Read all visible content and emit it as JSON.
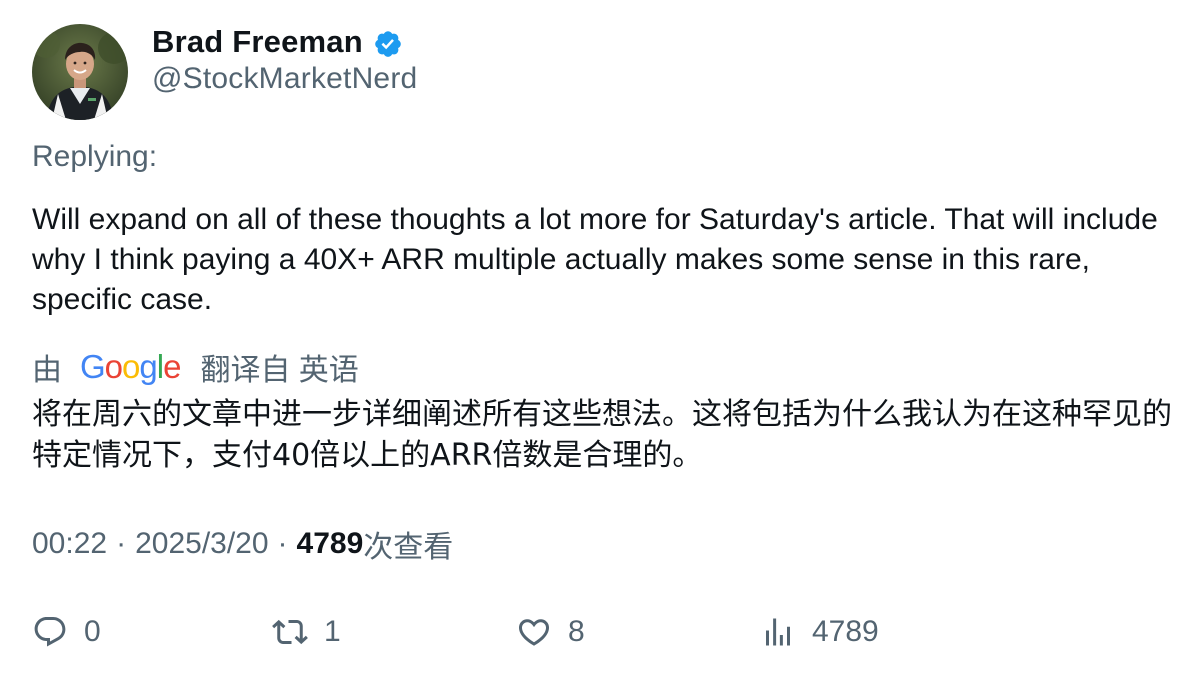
{
  "user": {
    "display_name": "Brad Freeman",
    "handle": "@StockMarketNerd",
    "verified": true,
    "verified_color": "#1d9bf0"
  },
  "tweet": {
    "replying_label": "Replying:",
    "text": "Will expand on all of these thoughts a lot more for Saturday's article. That will include why I think paying a 40X+ ARR multiple actually makes some sense in this rare, specific case."
  },
  "translation": {
    "by_label": "由",
    "provider": "Google",
    "provider_letters": [
      {
        "ch": "G",
        "color": "#4285F4"
      },
      {
        "ch": "o",
        "color": "#EA4335"
      },
      {
        "ch": "o",
        "color": "#FBBC05"
      },
      {
        "ch": "g",
        "color": "#4285F4"
      },
      {
        "ch": "l",
        "color": "#34A853"
      },
      {
        "ch": "e",
        "color": "#EA4335"
      }
    ],
    "translated_from_label": "翻译自 英语",
    "text": "将在周六的文章中进一步详细阐述所有这些想法。这将包括为什么我认为在这种罕见的特定情况下，支付40倍以上的ARR倍数是合理的。"
  },
  "meta": {
    "time": "00:22",
    "separator": "·",
    "date": "2025/3/20",
    "views_count": "4789",
    "views_label": "次查看"
  },
  "actions": {
    "reply_count": "0",
    "retweet_count": "1",
    "like_count": "8",
    "views_count": "4789",
    "icons": [
      "reply-icon",
      "retweet-icon",
      "like-icon",
      "views-icon"
    ]
  },
  "colors": {
    "text_primary": "#0f1419",
    "text_secondary": "#536471",
    "accent": "#1d9bf0"
  }
}
